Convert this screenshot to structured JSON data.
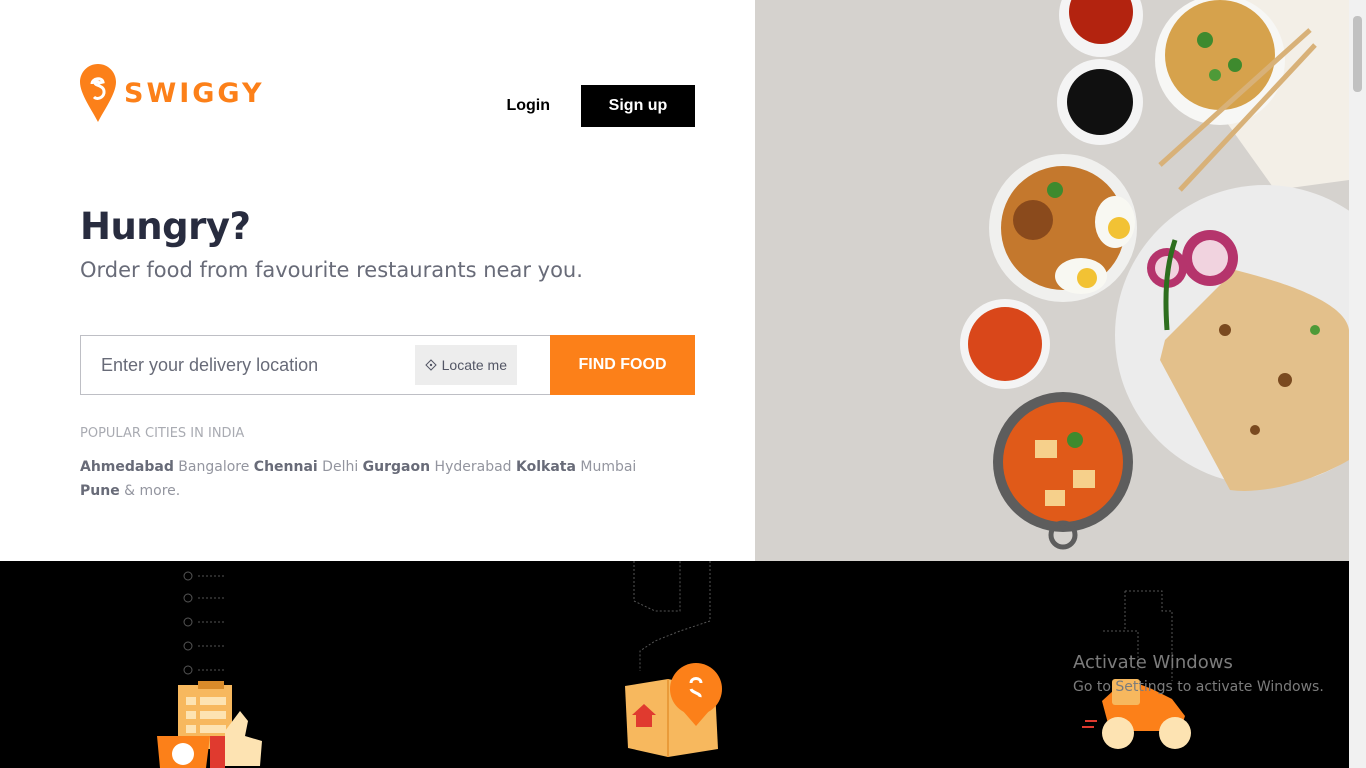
{
  "brand": {
    "name": "SWIGGY",
    "color": "#fc8019"
  },
  "nav": {
    "login": "Login",
    "signup": "Sign up"
  },
  "hero": {
    "title": "Hungry?",
    "subtitle": "Order food from favourite restaurants near you."
  },
  "search": {
    "placeholder": "Enter your delivery location",
    "locate_label": "Locate me",
    "find_label": "FIND FOOD"
  },
  "cities": {
    "title": "POPULAR CITIES IN INDIA",
    "items": [
      {
        "name": "Ahmedabad",
        "bold": true
      },
      {
        "name": "Bangalore",
        "bold": false
      },
      {
        "name": "Chennai",
        "bold": true
      },
      {
        "name": "Delhi",
        "bold": false
      },
      {
        "name": "Gurgaon",
        "bold": true
      },
      {
        "name": "Hyderabad",
        "bold": false
      },
      {
        "name": "Kolkata",
        "bold": true
      },
      {
        "name": "Mumbai",
        "bold": false
      },
      {
        "name": "Pune",
        "bold": true
      }
    ],
    "more": "& more."
  },
  "icons": [
    "swiggy-logo-icon",
    "crosshair-icon",
    "food-platter-image",
    "order-checklist-icon",
    "map-pin-icon",
    "delivery-scooter-icon"
  ],
  "watermark": {
    "title": "Activate Windows",
    "subtitle": "Go to Settings to activate Windows."
  }
}
